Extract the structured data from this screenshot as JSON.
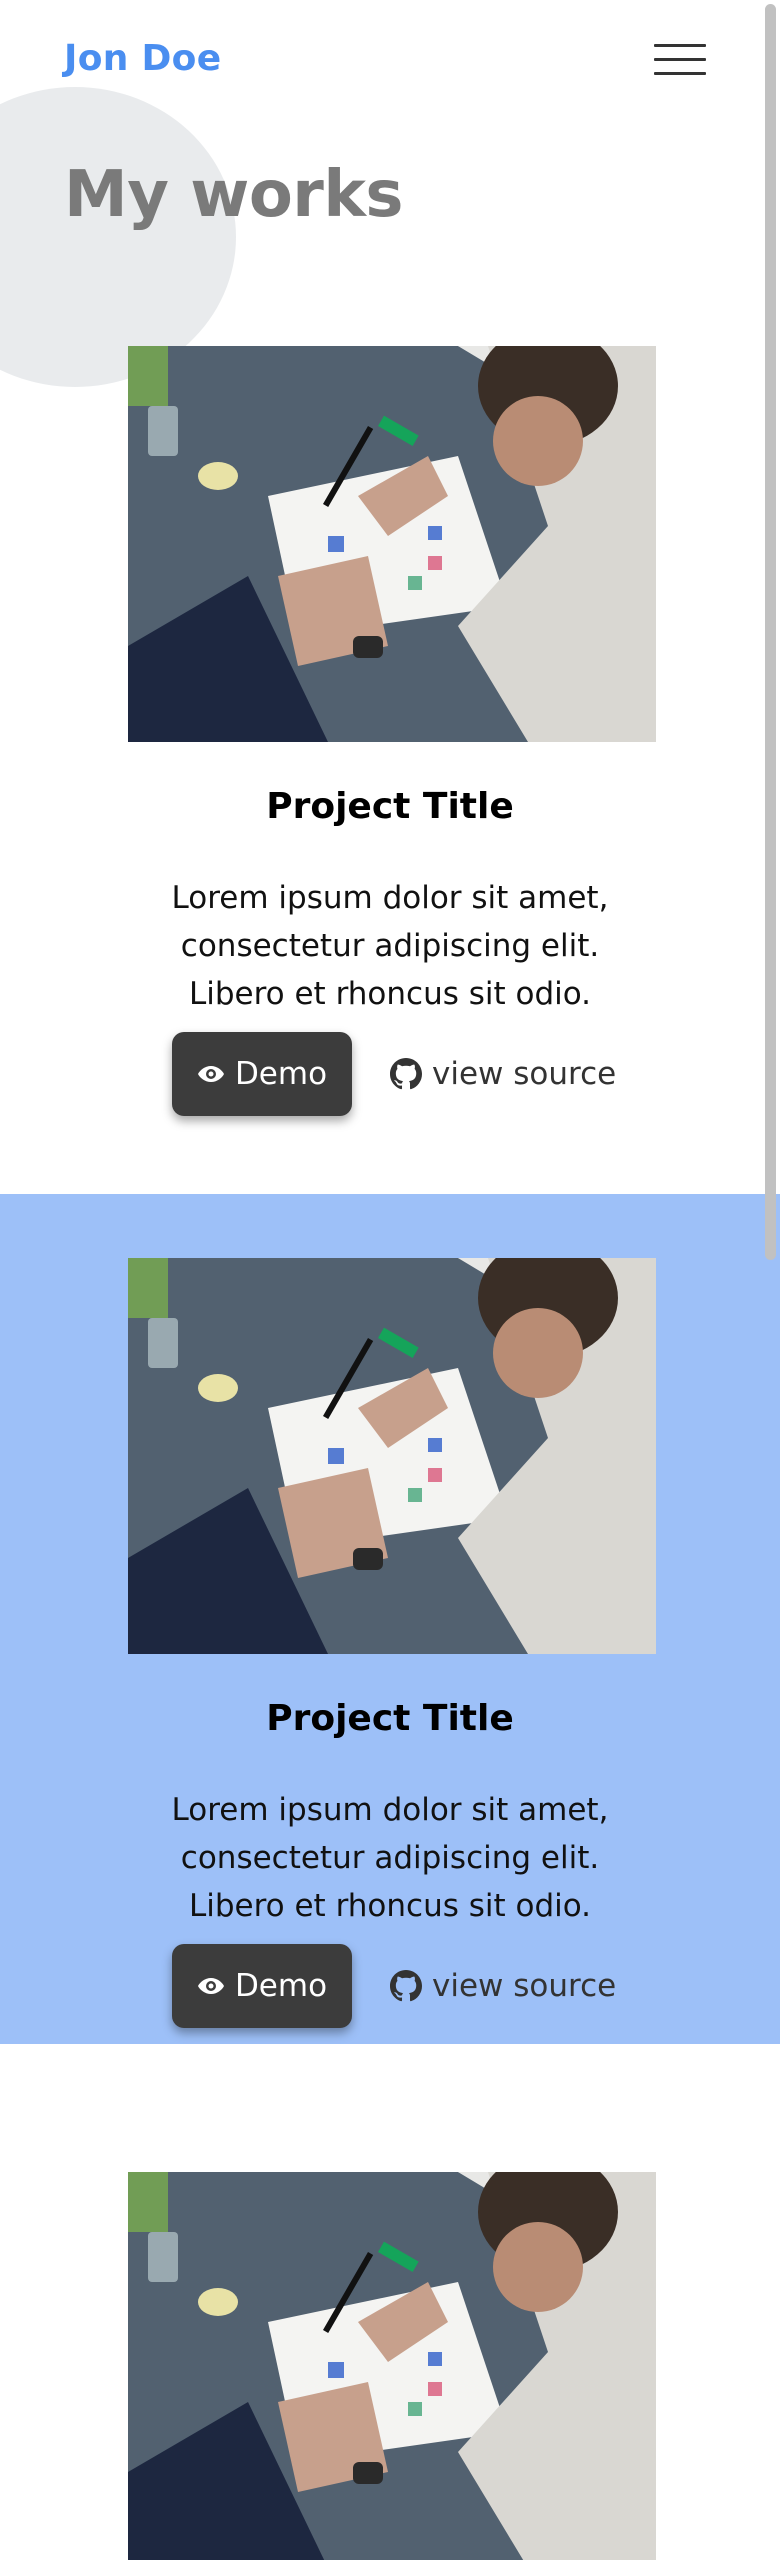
{
  "header": {
    "brand": "Jon Doe",
    "menu_icon": "hamburger-menu-icon"
  },
  "page_title": "My works",
  "projects": [
    {
      "title": "Project Title",
      "description": "Lorem ipsum dolor sit amet, consectetur adipiscing elit. Libero et rhoncus sit odio.",
      "demo_label": "Demo",
      "demo_icon": "eye-icon",
      "source_label": "view source",
      "source_icon": "github-icon",
      "image": "photo of person sketching a UI layout with markers"
    },
    {
      "title": "Project Title",
      "description": "Lorem ipsum dolor sit amet, consectetur adipiscing elit. Libero et rhoncus sit odio.",
      "demo_label": "Demo",
      "demo_icon": "eye-icon",
      "source_label": "view source",
      "source_icon": "github-icon",
      "image": "photo of person sketching a UI layout with markers"
    },
    {
      "title": "",
      "description": "",
      "image": "photo of person sketching a UI layout with markers"
    }
  ],
  "colors": {
    "brand": "#4a8ef0",
    "title_gray": "#7a7a7a",
    "alt_section_bg": "#9dc0f8",
    "demo_button_bg": "#3c3c3c"
  }
}
